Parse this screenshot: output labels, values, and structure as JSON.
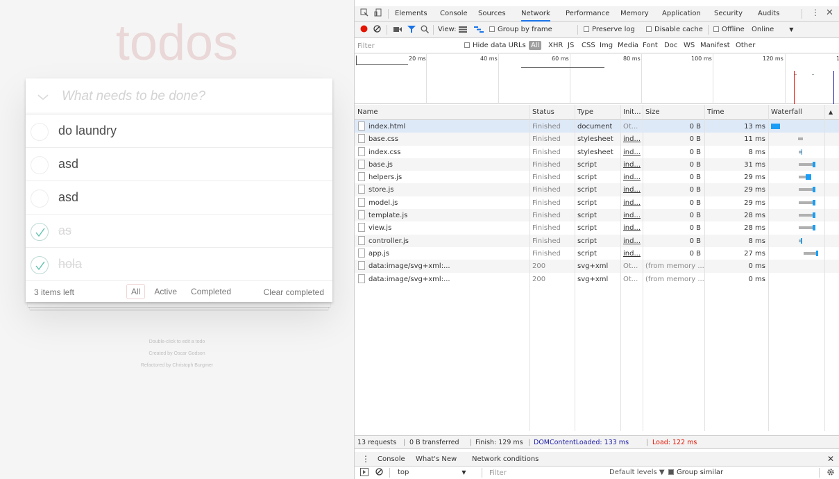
{
  "todo": {
    "title": "todos",
    "new_placeholder": "What needs to be done?",
    "items": [
      {
        "label": "do laundry",
        "completed": false
      },
      {
        "label": "asd",
        "completed": false
      },
      {
        "label": "asd",
        "completed": false
      },
      {
        "label": "as",
        "completed": true
      },
      {
        "label": "hola",
        "completed": true
      }
    ],
    "footer": {
      "count": "3 items left",
      "filters": [
        "All",
        "Active",
        "Completed"
      ],
      "selected_filter": "All",
      "clear_completed": "Clear completed"
    },
    "info": [
      "Double-click to edit a todo",
      "Created by Oscar Godson",
      "Refactored by Christoph Burgmer"
    ]
  },
  "devtools": {
    "tabs": [
      "Elements",
      "Console",
      "Sources",
      "Network",
      "Performance",
      "Memory",
      "Application",
      "Security",
      "Audits"
    ],
    "active_tab": "Network",
    "toolbar": {
      "view_label": "View:",
      "group_by_frame": "Group by frame",
      "preserve_log": "Preserve log",
      "disable_cache": "Disable cache",
      "offline": "Offline",
      "throttle": "Online"
    },
    "filter": {
      "placeholder": "Filter",
      "hide_data_urls": "Hide data URLs",
      "types": [
        "All",
        "XHR",
        "JS",
        "CSS",
        "Img",
        "Media",
        "Font",
        "Doc",
        "WS",
        "Manifest",
        "Other"
      ]
    },
    "overview_ticks": [
      "20 ms",
      "40 ms",
      "60 ms",
      "80 ms",
      "100 ms",
      "120 ms",
      "1"
    ],
    "columns": [
      "Name",
      "Status",
      "Type",
      "Init...",
      "Size",
      "Time",
      "Waterfall"
    ],
    "requests": [
      {
        "name": "index.html",
        "status": "Finished",
        "type": "document",
        "initiator": "Ot...",
        "size": "0 B",
        "time": "13 ms",
        "wf_start": 0,
        "wf_wait": 0,
        "wf_dl": 13
      },
      {
        "name": "base.css",
        "status": "Finished",
        "type": "stylesheet",
        "initiator": "ind...",
        "size": "0 B",
        "time": "11 ms",
        "wf_start": 39,
        "wf_wait": 7,
        "wf_dl": 0
      },
      {
        "name": "index.css",
        "status": "Finished",
        "type": "stylesheet",
        "initiator": "ind...",
        "size": "0 B",
        "time": "8 ms",
        "wf_start": 40,
        "wf_wait": 4,
        "wf_dl": 2
      },
      {
        "name": "base.js",
        "status": "Finished",
        "type": "script",
        "initiator": "ind...",
        "size": "0 B",
        "time": "31 ms",
        "wf_start": 40,
        "wf_wait": 20,
        "wf_dl": 6
      },
      {
        "name": "helpers.js",
        "status": "Finished",
        "type": "script",
        "initiator": "ind...",
        "size": "0 B",
        "time": "29 ms",
        "wf_start": 40,
        "wf_wait": 10,
        "wf_dl": 12
      },
      {
        "name": "store.js",
        "status": "Finished",
        "type": "script",
        "initiator": "ind...",
        "size": "0 B",
        "time": "29 ms",
        "wf_start": 40,
        "wf_wait": 20,
        "wf_dl": 6
      },
      {
        "name": "model.js",
        "status": "Finished",
        "type": "script",
        "initiator": "ind...",
        "size": "0 B",
        "time": "29 ms",
        "wf_start": 40,
        "wf_wait": 20,
        "wf_dl": 6
      },
      {
        "name": "template.js",
        "status": "Finished",
        "type": "script",
        "initiator": "ind...",
        "size": "0 B",
        "time": "28 ms",
        "wf_start": 40,
        "wf_wait": 20,
        "wf_dl": 6
      },
      {
        "name": "view.js",
        "status": "Finished",
        "type": "script",
        "initiator": "ind...",
        "size": "0 B",
        "time": "28 ms",
        "wf_start": 40,
        "wf_wait": 20,
        "wf_dl": 6
      },
      {
        "name": "controller.js",
        "status": "Finished",
        "type": "script",
        "initiator": "ind...",
        "size": "0 B",
        "time": "8 ms",
        "wf_start": 40,
        "wf_wait": 3,
        "wf_dl": 3
      },
      {
        "name": "app.js",
        "status": "Finished",
        "type": "script",
        "initiator": "ind...",
        "size": "0 B",
        "time": "27 ms",
        "wf_start": 47,
        "wf_wait": 18,
        "wf_dl": 4
      },
      {
        "name": "data:image/svg+xml:...",
        "status": "200",
        "type": "svg+xml",
        "initiator": "Ot...",
        "size": "(from memory ...",
        "time": "0 ms",
        "wf_start": null,
        "wf_wait": 0,
        "wf_dl": 0
      },
      {
        "name": "data:image/svg+xml:...",
        "status": "200",
        "type": "svg+xml",
        "initiator": "Ot...",
        "size": "(from memory ...",
        "time": "0 ms",
        "wf_start": null,
        "wf_wait": 0,
        "wf_dl": 0
      }
    ],
    "summary": {
      "requests": "13 requests",
      "transferred": "0 B transferred",
      "finish": "Finish: 129 ms",
      "dcl": "DOMContentLoaded: 133 ms",
      "load": "Load: 122 ms"
    },
    "drawer_tabs": [
      "Console",
      "What's New",
      "Network conditions"
    ],
    "console": {
      "context": "top",
      "filter_placeholder": "Filter",
      "levels": "Default levels ▼",
      "group_similar": "Group similar"
    },
    "colors": {
      "record": "#e51400",
      "accent": "#1a73e8",
      "filter_icon": "#1a73e8",
      "waterfall_download": "#1a9df5",
      "waterfall_wait": "#b0b0b0",
      "dcl": "#1a1aa6",
      "load": "#e51400"
    },
    "icons": {
      "inspect": "inspect-element-icon",
      "device": "device-toolbar-icon",
      "record": "record-icon",
      "clear": "clear-icon",
      "camera": "capture-screenshots-icon",
      "filter": "filter-icon",
      "search": "search-icon",
      "more": "more-vertical-icon",
      "close": "close-icon",
      "settings": "gear-icon"
    }
  }
}
